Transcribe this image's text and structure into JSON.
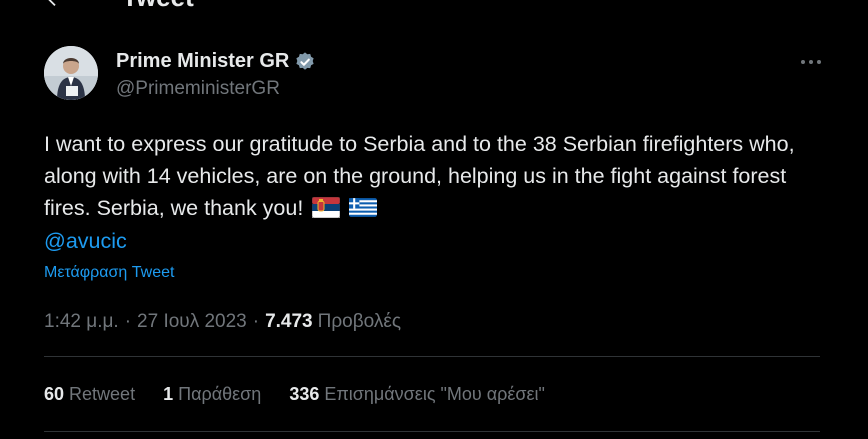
{
  "header": {
    "title": "Tweet",
    "back_icon": "arrow-left-icon"
  },
  "author": {
    "name": "Prime Minister GR",
    "handle": "@PrimeministerGR",
    "verified_icon": "verified-badge-icon",
    "verified_color": "#829aab"
  },
  "tweet": {
    "text": "I want to express our gratitude to Serbia and to the 38 Serbian firefighters who, along with 14 vehicles, are on the ground, helping us in the fight against forest fires. Serbia, we thank you!",
    "flags": [
      "serbia-flag-icon",
      "greece-flag-icon"
    ],
    "mention": "@avucic",
    "translate_label": "Μετάφραση Tweet"
  },
  "meta": {
    "time": "1:42 μ.μ.",
    "separator": "·",
    "date": "27 Ιουλ 2023",
    "views_count": "7.473",
    "views_label": "Προβολές"
  },
  "stats": {
    "retweets_count": "60",
    "retweets_label": "Retweet",
    "quotes_count": "1",
    "quotes_label": "Παράθεση",
    "likes_count": "336",
    "likes_label": "Επισημάνσεις \"Μου αρέσει\""
  },
  "colors": {
    "background": "#000000",
    "text": "#e7e9ea",
    "secondary": "#71767b",
    "link": "#1d9bf0",
    "divider": "#2f3336"
  }
}
